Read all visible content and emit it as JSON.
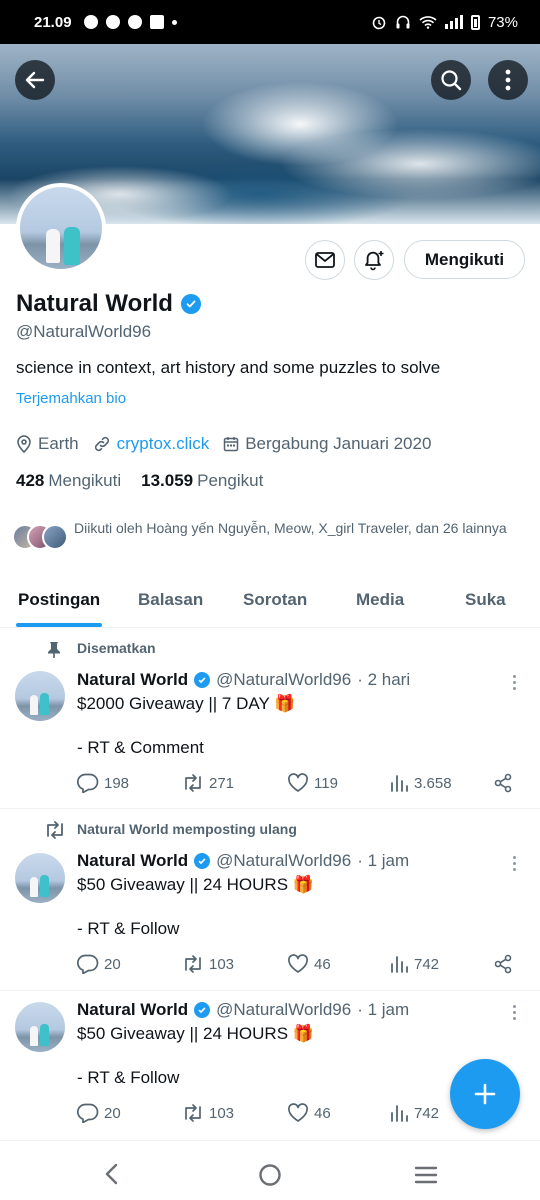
{
  "status_bar": {
    "time": "21.09",
    "battery": "73%",
    "left_icons": [
      "chat-bubble-icon",
      "facebook-icon",
      "facebook-icon",
      "tiktok-icon"
    ],
    "right_icons": [
      "alarm-icon",
      "headphones-icon",
      "wifi-icon",
      "signal-icon",
      "battery-icon"
    ]
  },
  "header": {
    "back_icon": "back-arrow-icon",
    "search_icon": "search-icon",
    "more_icon": "more-vertical-icon"
  },
  "profile": {
    "name": "Natural World",
    "handle": "@NaturalWorld96",
    "bio": "science in context, art history and some puzzles to solve",
    "translate_label": "Terjemahkan bio",
    "location": "Earth",
    "link": "cryptox.click",
    "joined": "Bergabung Januari 2020",
    "following_count": "428",
    "following_label": "Mengikuti",
    "followers_count": "13.059",
    "followers_label": "Pengikut",
    "followed_by": "Diikuti oleh Hoàng yến Nguyễn, Meow, X_girl Traveler, dan 26 lainnya",
    "follow_button": "Mengikuti"
  },
  "tabs": [
    {
      "label": "Postingan",
      "active": true
    },
    {
      "label": "Balasan",
      "active": false
    },
    {
      "label": "Sorotan",
      "active": false
    },
    {
      "label": "Media",
      "active": false
    },
    {
      "label": "Suka",
      "active": false
    }
  ],
  "posts": [
    {
      "context": "Disematkan",
      "author": "Natural World",
      "handle": "@NaturalWorld96",
      "time": "· 2 hari",
      "line1": "$2000 Giveaway  || 7 DAY 🎁",
      "line2": "- RT & Comment",
      "replies": "198",
      "reposts": "271",
      "likes": "119",
      "views": "3.658"
    },
    {
      "context": "Natural World memposting ulang",
      "author": "Natural World",
      "handle": "@NaturalWorld96",
      "time": "· 1 jam",
      "line1": "$50 Giveaway  || 24 HOURS 🎁",
      "line2": "- RT & Follow",
      "replies": "20",
      "reposts": "103",
      "likes": "46",
      "views": "742"
    },
    {
      "context": "",
      "author": "Natural World",
      "handle": "@NaturalWorld96",
      "time": "· 1 jam",
      "line1": "$50 Giveaway  || 24 HOURS 🎁",
      "line2": "- RT & Follow",
      "replies": "20",
      "reposts": "103",
      "likes": "46",
      "views": "742"
    }
  ],
  "colors": {
    "accent": "#1d9bf0",
    "text": "#0f1419",
    "muted": "#536471",
    "border": "#eff3f4"
  }
}
